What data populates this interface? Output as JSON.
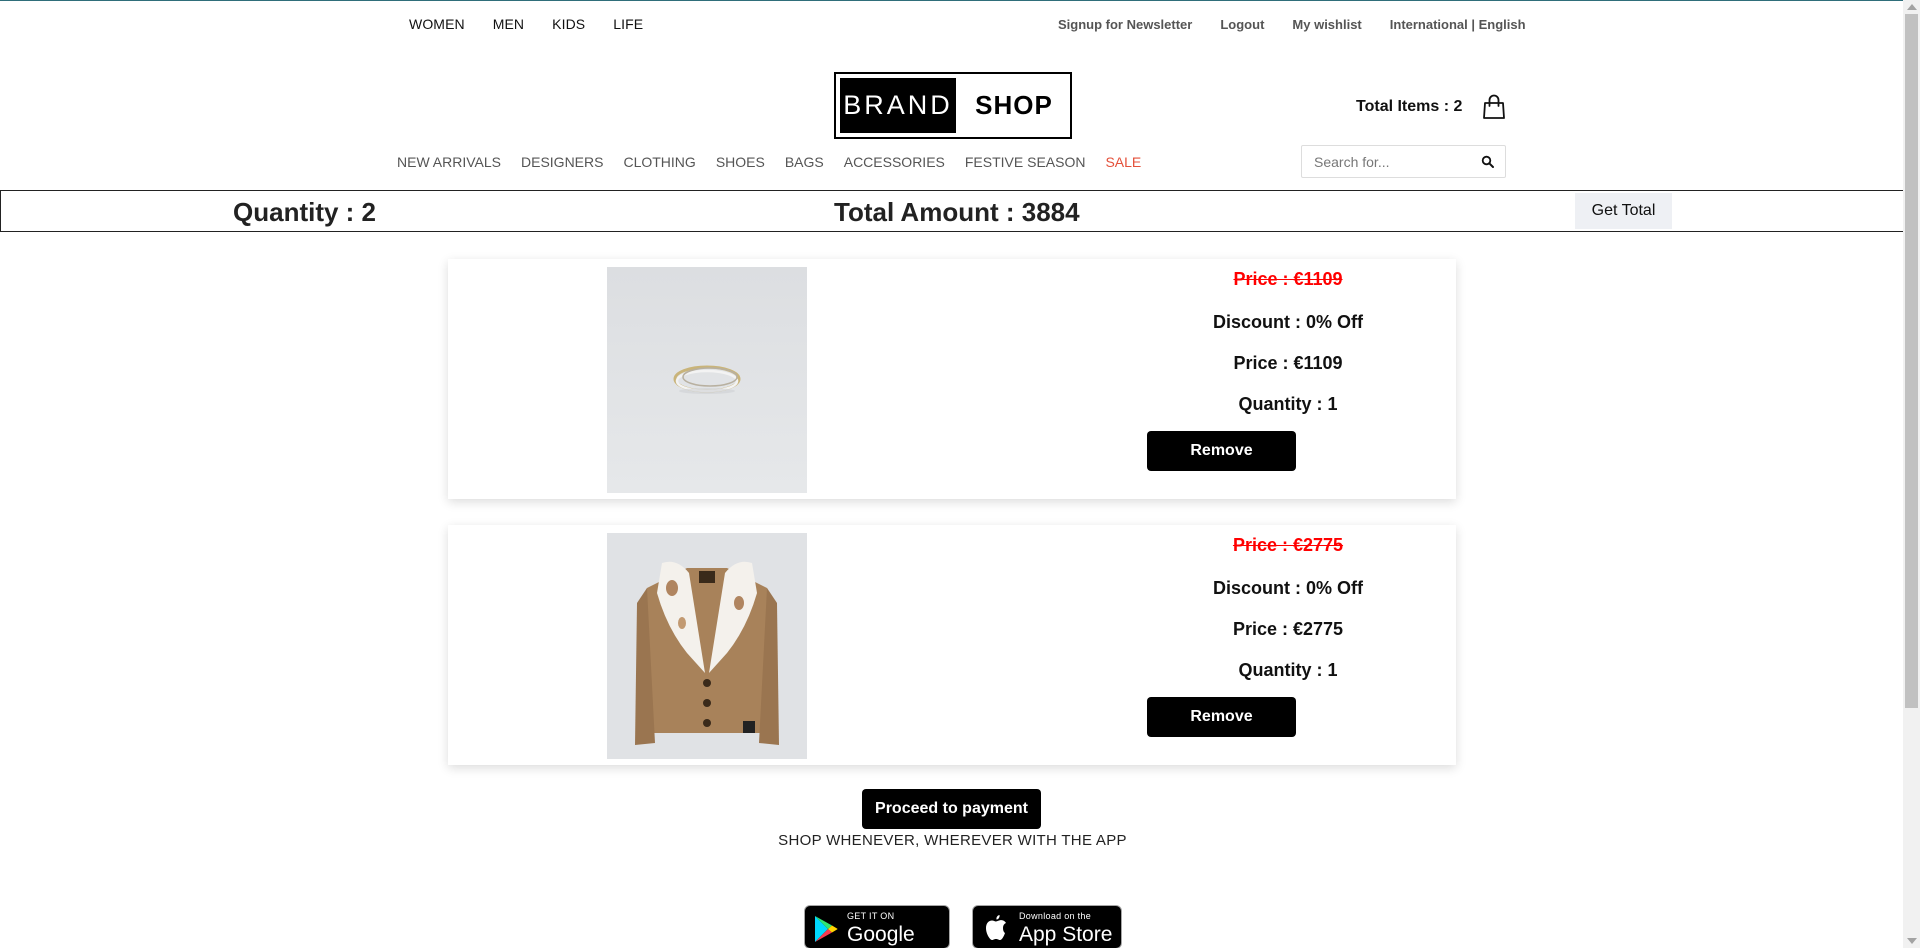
{
  "top_nav": {
    "left": [
      "WOMEN",
      "MEN",
      "KIDS",
      "LIFE"
    ],
    "right": [
      "Signup for Newsletter",
      "Logout",
      "My wishlist",
      "International | English"
    ]
  },
  "logo": {
    "left": "BRAND",
    "right": "SHOP"
  },
  "cart": {
    "label": "Total Items : 2",
    "icon": "shopping-bag-icon"
  },
  "category_nav": [
    "NEW ARRIVALS",
    "DESIGNERS",
    "CLOTHING",
    "SHOES",
    "BAGS",
    "ACCESSORIES",
    "FESTIVE SEASON",
    "SALE"
  ],
  "search": {
    "placeholder": "Search for...",
    "icon": "search-icon"
  },
  "summary": {
    "quantity": "Quantity : 2",
    "total_amount": "Total Amount : 3884",
    "get_total_label": "Get Total"
  },
  "products": [
    {
      "image": "ring-image",
      "original_price": "Price : €1109",
      "discount": "Discount : 0% Off",
      "price": "Price : €1109",
      "quantity": "Quantity : 1",
      "remove_label": "Remove"
    },
    {
      "image": "fur-collar-cardigan-image",
      "original_price": "Price : €2775",
      "discount": "Discount : 0% Off",
      "price": "Price : €2775",
      "quantity": "Quantity : 1",
      "remove_label": "Remove"
    }
  ],
  "proceed_label": "Proceed to payment",
  "tagline": "SHOP WHENEVER, WHEREVER WITH THE APP",
  "app_badges": {
    "google_small": "GET IT ON",
    "google_big": "Google Play",
    "apple_small": "Download on the",
    "apple_big": "App Store"
  },
  "colors": {
    "sale": "#e4513b",
    "strike_price": "#ff0000",
    "button": "#000000"
  }
}
